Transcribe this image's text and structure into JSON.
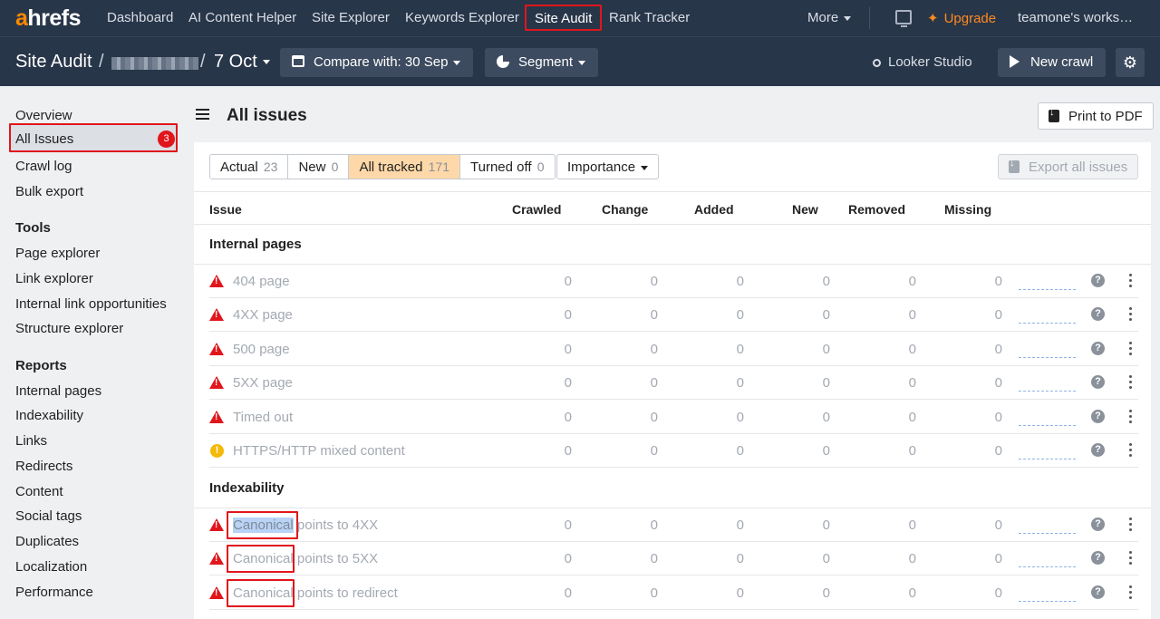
{
  "topnav": {
    "logo_a": "a",
    "logo_rest": "hrefs",
    "items": [
      {
        "label": "Dashboard"
      },
      {
        "label": "AI Content Helper"
      },
      {
        "label": "Site Explorer"
      },
      {
        "label": "Keywords Explorer"
      },
      {
        "label": "Site Audit"
      },
      {
        "label": "Rank Tracker"
      }
    ],
    "more": "More",
    "upgrade": "Upgrade",
    "workspace": "teamone's works…",
    "accent": "#ff8800"
  },
  "subheader": {
    "title": "Site Audit",
    "slash": "/",
    "date": "7 Oct",
    "compare": "Compare with: 30 Sep",
    "segment": "Segment",
    "looker": "Looker Studio",
    "new_crawl": "New crawl"
  },
  "sidebar": {
    "items": [
      "Overview",
      "All Issues",
      "Crawl log",
      "Bulk export"
    ],
    "issues_badge": "3",
    "tools_heading": "Tools",
    "tools": [
      "Page explorer",
      "Link explorer",
      "Internal link opportunities",
      "Structure explorer"
    ],
    "reports_heading": "Reports",
    "reports": [
      "Internal pages",
      "Indexability",
      "Links",
      "Redirects",
      "Content",
      "Social tags",
      "Duplicates",
      "Localization",
      "Performance"
    ]
  },
  "main": {
    "title": "All issues",
    "print": "Print to PDF",
    "filters": [
      {
        "label": "Actual",
        "count": "23"
      },
      {
        "label": "New",
        "count": "0"
      },
      {
        "label": "All tracked",
        "count": "171"
      },
      {
        "label": "Turned off",
        "count": "0"
      }
    ],
    "importance": "Importance",
    "export": "Export all issues",
    "columns": [
      "Issue",
      "Crawled",
      "Change",
      "Added",
      "New",
      "Removed",
      "Missing"
    ],
    "sections": [
      {
        "heading": "Internal pages",
        "rows": [
          {
            "name": "404 page",
            "level": "error",
            "values": [
              "0",
              "0",
              "0",
              "0",
              "0",
              "0"
            ]
          },
          {
            "name": "4XX page",
            "level": "error",
            "values": [
              "0",
              "0",
              "0",
              "0",
              "0",
              "0"
            ]
          },
          {
            "name": "500 page",
            "level": "error",
            "values": [
              "0",
              "0",
              "0",
              "0",
              "0",
              "0"
            ]
          },
          {
            "name": "5XX page",
            "level": "error",
            "values": [
              "0",
              "0",
              "0",
              "0",
              "0",
              "0"
            ]
          },
          {
            "name": "Timed out",
            "level": "error",
            "values": [
              "0",
              "0",
              "0",
              "0",
              "0",
              "0"
            ]
          },
          {
            "name": "HTTPS/HTTP mixed content",
            "level": "warning",
            "values": [
              "0",
              "0",
              "0",
              "0",
              "0",
              "0"
            ]
          }
        ]
      },
      {
        "heading": "Indexability",
        "rows": [
          {
            "name_hl": "Canonical",
            "name_rest": " points to 4XX",
            "level": "error",
            "values": [
              "0",
              "0",
              "0",
              "0",
              "0",
              "0"
            ]
          },
          {
            "name_hl": "Canonical",
            "name_rest": " points to 5XX",
            "level": "error",
            "values": [
              "0",
              "0",
              "0",
              "0",
              "0",
              "0"
            ]
          },
          {
            "name_hl": "Canonical",
            "name_rest": " points to redirect",
            "level": "error",
            "values": [
              "0",
              "0",
              "0",
              "0",
              "0",
              "0"
            ]
          }
        ]
      }
    ]
  }
}
